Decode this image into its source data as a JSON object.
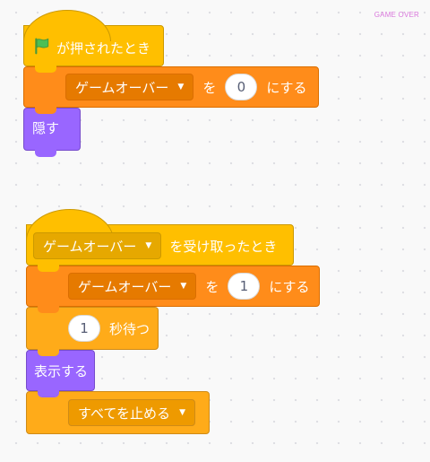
{
  "stage": {
    "label": "GAME OVER"
  },
  "script1": {
    "hat": {
      "label": "が押されたとき",
      "icon": "green-flag-icon"
    },
    "set": {
      "variable": "ゲームオーバー",
      "to_label": "を",
      "value": "0",
      "suffix": "にする"
    },
    "hide": {
      "label": "隠す"
    }
  },
  "script2": {
    "hat": {
      "message": "ゲームオーバー",
      "suffix": "を受け取ったとき"
    },
    "set": {
      "variable": "ゲームオーバー",
      "to_label": "を",
      "value": "1",
      "suffix": "にする"
    },
    "wait": {
      "value": "1",
      "suffix": "秒待つ"
    },
    "show": {
      "label": "表示する"
    },
    "stop": {
      "option": "すべてを止める"
    }
  },
  "colors": {
    "events": "#ffbf00",
    "variables": "#ff8c1a",
    "looks": "#9966ff",
    "control": "#ffab19",
    "stage_label": "#d977dc"
  }
}
